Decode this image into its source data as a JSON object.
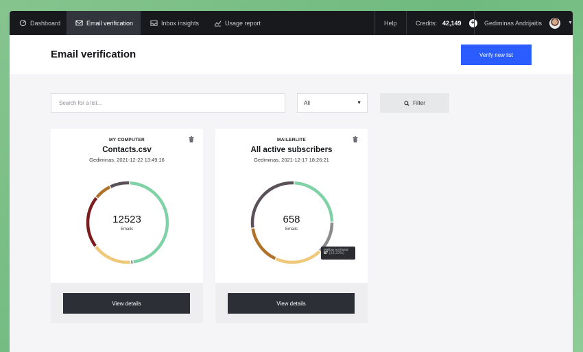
{
  "nav": {
    "items": [
      {
        "label": "Dashboard",
        "icon": "dashboard-icon"
      },
      {
        "label": "Email verification",
        "icon": "email-check-icon",
        "active": true
      },
      {
        "label": "Inbox insights",
        "icon": "inbox-icon"
      },
      {
        "label": "Usage report",
        "icon": "chart-line-icon"
      }
    ],
    "help": "Help",
    "credits_label": "Credits:",
    "credits_value": "42,149",
    "user_name": "Gediminas Andrijaitis"
  },
  "header": {
    "title": "Email verification",
    "verify_button": "Verify new list"
  },
  "filters": {
    "search_placeholder": "Search for a list...",
    "select_value": "All",
    "filter_button": "Filter"
  },
  "colors": {
    "accent": "#2a5cff",
    "green": "#7fd1a6",
    "dark_gray": "#5b5159",
    "brown": "#b0722a",
    "dark_red": "#7b1d1d",
    "yellow": "#f0c87a",
    "gray": "#8c8c8c"
  },
  "cards": [
    {
      "source": "MY COMPUTER",
      "name": "Contacts.csv",
      "meta": "Gediminas, 2021-12-22 13:49:16",
      "count": "12523",
      "count_label": "Emails",
      "details_button": "View details",
      "segments": [
        {
          "color": "#7fd1a6",
          "fraction": 0.47
        },
        {
          "color": "#8c8c8c",
          "fraction": 0.01
        },
        {
          "color": "#f0c87a",
          "fraction": 0.16
        },
        {
          "color": "#7b1d1d",
          "fraction": 0.21
        },
        {
          "color": "#b0722a",
          "fraction": 0.07
        },
        {
          "color": "#5b5159",
          "fraction": 0.08
        }
      ]
    },
    {
      "source": "MAILERLITE",
      "name": "All active subscribers",
      "meta": "Gediminas, 2021-12-17 18:26:21",
      "count": "658",
      "count_label": "Emails",
      "details_button": "View details",
      "tooltip": {
        "label": "Mailbox not found",
        "value": "87",
        "percent": "(13.22%)"
      },
      "segments": [
        {
          "color": "#7fd1a6",
          "fraction": 0.24
        },
        {
          "color": "#8c8c8c",
          "fraction": 0.13
        },
        {
          "color": "#f0c87a",
          "fraction": 0.19
        },
        {
          "color": "#b0722a",
          "fraction": 0.16
        },
        {
          "color": "#5b5159",
          "fraction": 0.28
        }
      ]
    }
  ]
}
